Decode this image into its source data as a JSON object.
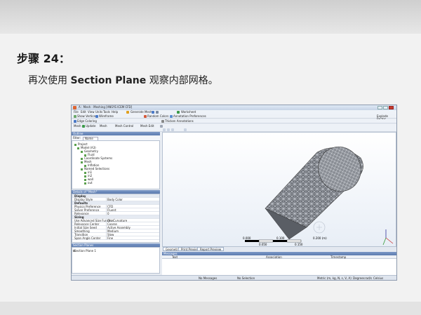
{
  "slide": {
    "step_label": "步骤 24：",
    "instruction_before": "再次使用 ",
    "instruction_bold": "Section Plane",
    "instruction_after": " 观察内部网格。"
  },
  "app": {
    "title": "A : Mesh - Meshing [ANSYS ICEM CFD]",
    "menu": [
      "File",
      "Edit",
      "View",
      "Units",
      "Tools",
      "Help"
    ],
    "toolbar1": {
      "generate_mesh": "Generate Mesh",
      "worksheet": "Worksheet"
    },
    "toolbar2": {
      "show_vertices": "Show Vertices",
      "wireframe": "Wireframe",
      "random_colors": "Random Colors",
      "annotation_preferences": "Annotation Preferences",
      "explode_factor": "Explode Factor:"
    },
    "toolbar3": {
      "edge_coloring": "Edge Coloring",
      "thicken_annotations": "Thicken Annotations"
    },
    "toolbar4": {
      "mesh": "Mesh",
      "update": "Update",
      "mesh_menu": "Mesh",
      "mesh_control": "Mesh Control",
      "mesh_edit": "Mesh Edit"
    },
    "outline": {
      "header": "Outline",
      "filter_label": "Filter:",
      "filter_value": "Name",
      "tree": [
        {
          "label": "Project",
          "indent": 1
        },
        {
          "label": "Model (A3)",
          "indent": 2
        },
        {
          "label": "Geometry",
          "indent": 3
        },
        {
          "label": "Fluid",
          "indent": 4
        },
        {
          "label": "Coordinate Systems",
          "indent": 3
        },
        {
          "label": "Mesh",
          "indent": 3
        },
        {
          "label": "Inflation",
          "indent": 4
        },
        {
          "label": "Named Selections",
          "indent": 3
        },
        {
          "label": "in1",
          "indent": 4
        },
        {
          "label": "in2",
          "indent": 4
        },
        {
          "label": "wall",
          "indent": 4
        },
        {
          "label": "out",
          "indent": 4
        }
      ]
    },
    "details": {
      "header": "Details of \"Mesh\"",
      "rows": [
        {
          "key": "Display",
          "value": "",
          "group": true
        },
        {
          "key": "Display Style",
          "value": "Body Color",
          "group": false
        },
        {
          "key": "Defaults",
          "value": "",
          "group": true
        },
        {
          "key": "Physics Preference",
          "value": "CFD",
          "group": false
        },
        {
          "key": "Solver Preference",
          "value": "Fluent",
          "group": false
        },
        {
          "key": "Relevance",
          "value": "0",
          "group": false
        },
        {
          "key": "Sizing",
          "value": "",
          "group": true
        },
        {
          "key": "Use Advanced Size Function",
          "value": "On: Curvature",
          "group": false
        },
        {
          "key": "Relevance Center",
          "value": "Coarse",
          "group": false
        },
        {
          "key": "Initial Size Seed",
          "value": "Active Assembly",
          "group": false
        },
        {
          "key": "Smoothing",
          "value": "Medium",
          "group": false
        },
        {
          "key": "Transition",
          "value": "Slow",
          "group": false
        },
        {
          "key": "Span Angle Center",
          "value": "Fine",
          "group": false
        }
      ]
    },
    "section_planes": {
      "header": "Section Planes",
      "items": [
        "Section Plane 1"
      ]
    },
    "viewport": {
      "scale_top": [
        "0.000",
        "0.100",
        "0.200 (m)"
      ],
      "scale_bottom": [
        "0.050",
        "0.150"
      ]
    },
    "tabs": [
      "Geometry",
      "Print Preview",
      "Report Preview"
    ],
    "messages": {
      "header": "Messages",
      "columns": [
        "Text",
        "Association",
        "Timestamp"
      ]
    },
    "status": {
      "messages": "No Messages",
      "selection": "No Selection",
      "units": "Metric (m, kg, N, s, V, A)",
      "angle": "Degrees",
      "rate": "rad/s",
      "temp": "Celsius"
    }
  }
}
